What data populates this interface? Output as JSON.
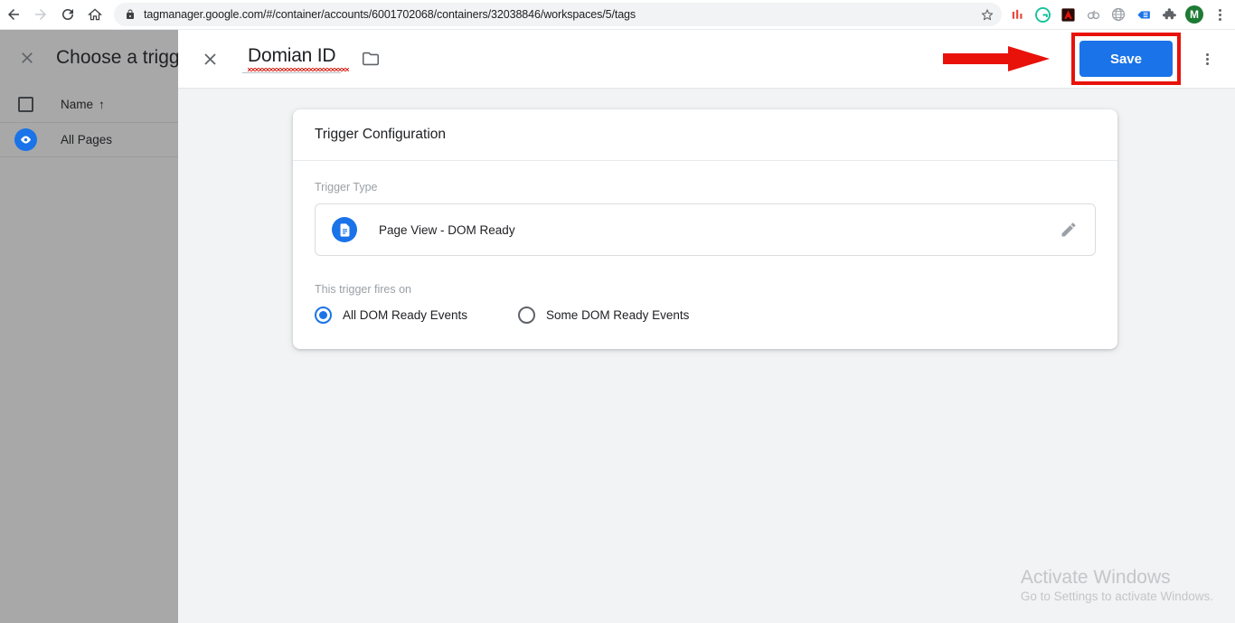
{
  "browser": {
    "back_icon": "back-arrow-icon",
    "forward_icon": "forward-arrow-icon",
    "reload_icon": "reload-icon",
    "home_icon": "home-icon",
    "lock_icon": "lock-icon",
    "url": "tagmanager.google.com/#/container/accounts/6001702068/containers/32038846/workspaces/5/tags",
    "star_icon": "bookmark-star-icon",
    "extensions": [
      {
        "name": "bar-chart-extension-icon",
        "glyph": "▐▌",
        "color": "#ea4335"
      },
      {
        "name": "grammarly-extension-icon",
        "glyph": "G",
        "color": "#15c39a"
      },
      {
        "name": "adobe-acrobat-extension-icon",
        "glyph": "A",
        "color": "#b30b00"
      },
      {
        "name": "chain-rings-extension-icon",
        "glyph": "♻",
        "color": "#9aa0a6"
      },
      {
        "name": "globe-extension-icon",
        "glyph": "⊕",
        "color": "#9aa0a6"
      },
      {
        "name": "tag-extension-icon",
        "glyph": "◀",
        "color": "#1a73e8"
      },
      {
        "name": "puzzle-extensions-icon",
        "glyph": "❖",
        "color": "#5f6368"
      }
    ],
    "profile_initial": "M",
    "menu_icon": "chrome-menu-icon"
  },
  "sidebar": {
    "close_icon": "close-icon",
    "title": "Choose a trigg",
    "column_header": "Name",
    "sort_arrow": "↑",
    "rows": [
      {
        "icon": "eye-icon",
        "name": "All Pages"
      }
    ]
  },
  "panel": {
    "close_icon": "close-icon",
    "title": "Domian ID",
    "folder_icon": "folder-icon",
    "save_label": "Save",
    "overflow_icon": "overflow-menu-icon",
    "annotation": "red-arrow-pointer"
  },
  "card": {
    "header": "Trigger Configuration",
    "trigger_type_label": "Trigger Type",
    "trigger": {
      "icon": "page-view-document-icon",
      "name": "Page View - DOM Ready",
      "edit_icon": "pencil-edit-icon"
    },
    "fires_on_label": "This trigger fires on",
    "options": [
      {
        "label": "All DOM Ready Events",
        "selected": true
      },
      {
        "label": "Some DOM Ready Events",
        "selected": false
      }
    ]
  },
  "watermark": {
    "title": "Activate Windows",
    "subtitle": "Go to Settings to activate Windows."
  },
  "colors": {
    "accent_blue": "#1a73e8",
    "annotation_red": "#e8120b",
    "panel_bg": "#f1f3f4",
    "scrim_gray": "#a8a8a8"
  }
}
